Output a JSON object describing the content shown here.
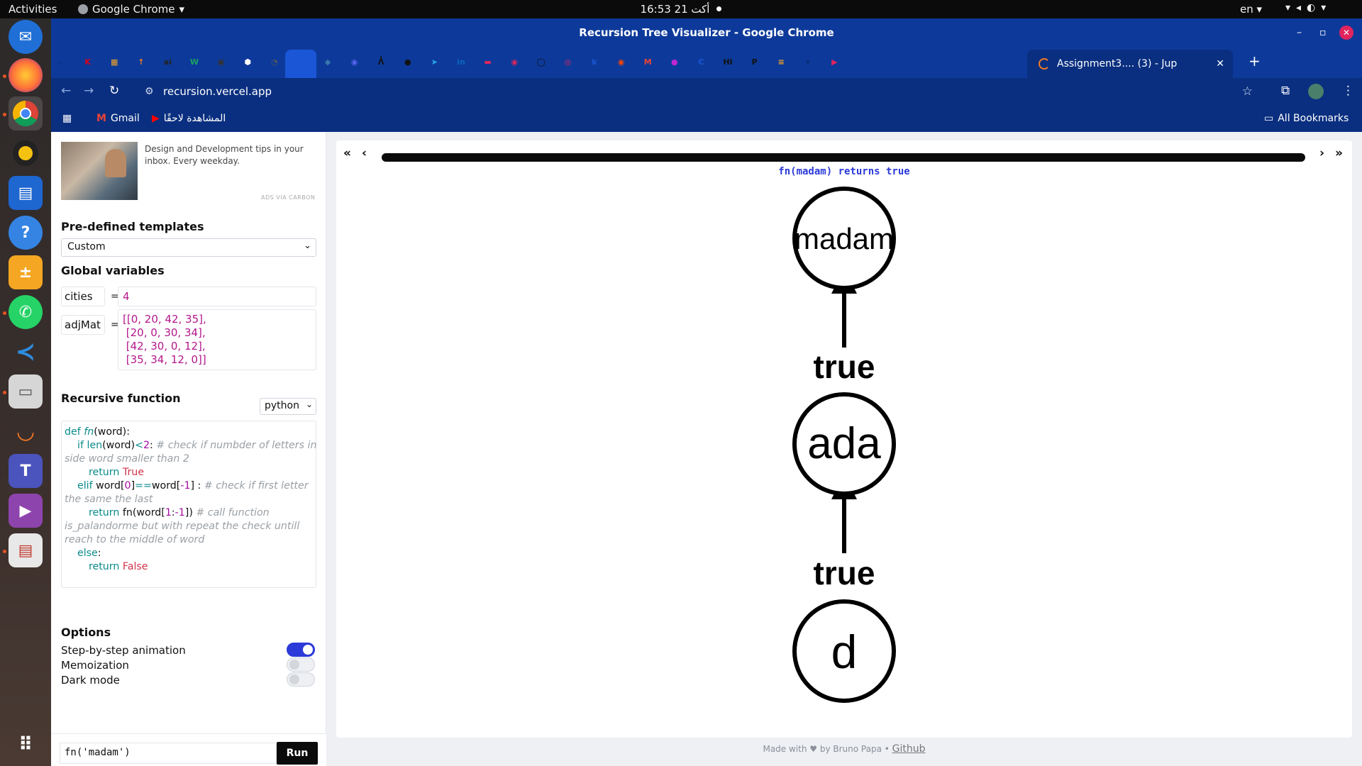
{
  "topbar": {
    "activities": "Activities",
    "app_name": "Google Chrome",
    "clock": "16:53  21 أكت",
    "lang": "en ▾",
    "sys_icons": "▾◂◐▾"
  },
  "dock": {
    "apps": [
      "Thunderbird",
      "Firefox",
      "Chrome",
      "Rhythmbox",
      "Writer",
      "Help",
      "Calculator",
      "WhatsApp",
      "VS Code",
      "Files",
      "Jupyter",
      "Teams",
      "Video",
      "Document Viewer",
      "Show Applications"
    ]
  },
  "window": {
    "title": "Recursion Tree Visualizer - Google Chrome",
    "minimize": "–",
    "restore": "▫",
    "close": "✕"
  },
  "tabs": {
    "active_title": "Assignment3.... (3) - Jup",
    "close": "✕",
    "new_tab": "+",
    "favicons": [
      {
        "label": "⌄",
        "color": "#0a2f80"
      },
      {
        "label": "K",
        "color": "#d6001c"
      },
      {
        "label": "▦",
        "color": "#f5a623"
      },
      {
        "label": "↑",
        "color": "#f47b20"
      },
      {
        "label": "ai",
        "color": "#222222"
      },
      {
        "label": "W",
        "color": "#1aa260"
      },
      {
        "label": "▣",
        "color": "#333333"
      },
      {
        "label": "⬢",
        "color": "#ffffff"
      },
      {
        "label": "◔",
        "color": "#555555"
      },
      {
        "label": "✣",
        "color": "#1a56d6"
      },
      {
        "label": "◆",
        "color": "#3776ab"
      },
      {
        "label": "◉",
        "color": "#5865f2"
      },
      {
        "label": "ᐰ",
        "color": "#111111"
      },
      {
        "label": "●",
        "color": "#111111"
      },
      {
        "label": "➤",
        "color": "#29a9eb"
      },
      {
        "label": "in",
        "color": "#0a66c2"
      },
      {
        "label": "▬",
        "color": "#e0245e"
      },
      {
        "label": "◉",
        "color": "#e0245e"
      },
      {
        "label": "◯",
        "color": "#111111"
      },
      {
        "label": "◎",
        "color": "#e0245e"
      },
      {
        "label": "k",
        "color": "#1a56d6"
      },
      {
        "label": "◉",
        "color": "#ff4500"
      },
      {
        "label": "M",
        "color": "#ea4335"
      },
      {
        "label": "●",
        "color": "#c026d3"
      },
      {
        "label": "C",
        "color": "#1a56d6"
      },
      {
        "label": "HI",
        "color": "#111111"
      },
      {
        "label": "P",
        "color": "#111111"
      },
      {
        "label": "≡",
        "color": "#f5a623"
      },
      {
        "label": "♦",
        "color": "#0a2f80"
      },
      {
        "label": "▶",
        "color": "#e0245e"
      }
    ]
  },
  "toolbar": {
    "back": "←",
    "forward": "→",
    "reload": "↻",
    "url": "recursion.vercel.app",
    "star": "☆",
    "extensions": "⧉",
    "menu": "⋮"
  },
  "bookmarks": {
    "apps": "▦",
    "items": [
      "Gmail",
      "المشاهدة لاحقًا"
    ],
    "all": "All Bookmarks"
  },
  "ad": {
    "text": "Design and Development tips in your inbox. Every weekday.",
    "via": "ADS VIA CARBON"
  },
  "templates": {
    "heading": "Pre-defined templates",
    "selected": "Custom"
  },
  "globals": {
    "heading": "Global variables",
    "vars": [
      {
        "name": "cities",
        "value": "4"
      },
      {
        "name": "adjMat",
        "value": "[[0, 20, 42, 35],\n [20, 0, 30, 34],\n [42, 30, 0, 12],\n [35, 34, 12, 0]]"
      }
    ]
  },
  "recursive": {
    "heading": "Recursive function",
    "language": "python"
  },
  "options": {
    "heading": "Options",
    "items": [
      {
        "label": "Step-by-step animation",
        "on": true
      },
      {
        "label": "Memoization",
        "on": false
      },
      {
        "label": "Dark mode",
        "on": false
      }
    ]
  },
  "call": {
    "value": "fn('madam')",
    "run": "Run"
  },
  "viewer": {
    "first": "«",
    "prev": "‹",
    "next": "›",
    "last": "»",
    "progress": 1.0,
    "status": "fn(madam) returns true"
  },
  "tree": {
    "nodes": [
      "madam",
      "ada",
      "d"
    ],
    "edges": [
      "true",
      "true"
    ]
  },
  "footer": {
    "made": "Made with ♥ by Bruno Papa •",
    "github": "Github"
  },
  "colors": {
    "accent": "#2b3ad8",
    "chrome_blue": "#0d3a9a",
    "ubuntu_orange": "#e95420"
  }
}
